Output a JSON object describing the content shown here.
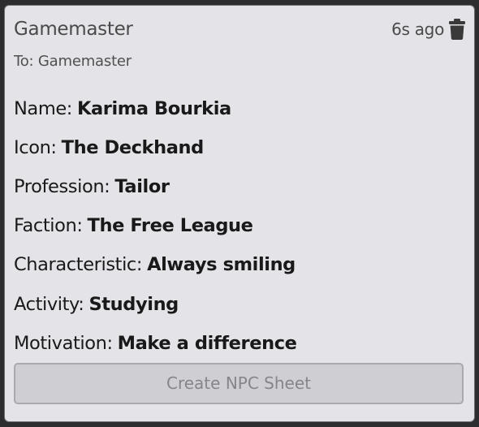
{
  "message": {
    "sender": "Gamemaster",
    "timestamp": "6s ago",
    "recipient": "To: Gamemaster",
    "delete_icon": "trash-icon"
  },
  "npc": {
    "fields": [
      {
        "label": "Name:",
        "value": "Karima Bourkia"
      },
      {
        "label": "Icon:",
        "value": "The Deckhand"
      },
      {
        "label": "Profession:",
        "value": "Tailor"
      },
      {
        "label": "Faction:",
        "value": "The Free League"
      },
      {
        "label": "Characteristic:",
        "value": "Always smiling"
      },
      {
        "label": "Activity:",
        "value": "Studying"
      },
      {
        "label": "Motivation:",
        "value": "Make a difference"
      }
    ]
  },
  "actions": {
    "create_sheet_label": "Create NPC Sheet"
  },
  "colors": {
    "background": "#2d2d2f",
    "card": "#e3e3e8",
    "button": "#cfcfd3",
    "button_text": "#86868a"
  }
}
